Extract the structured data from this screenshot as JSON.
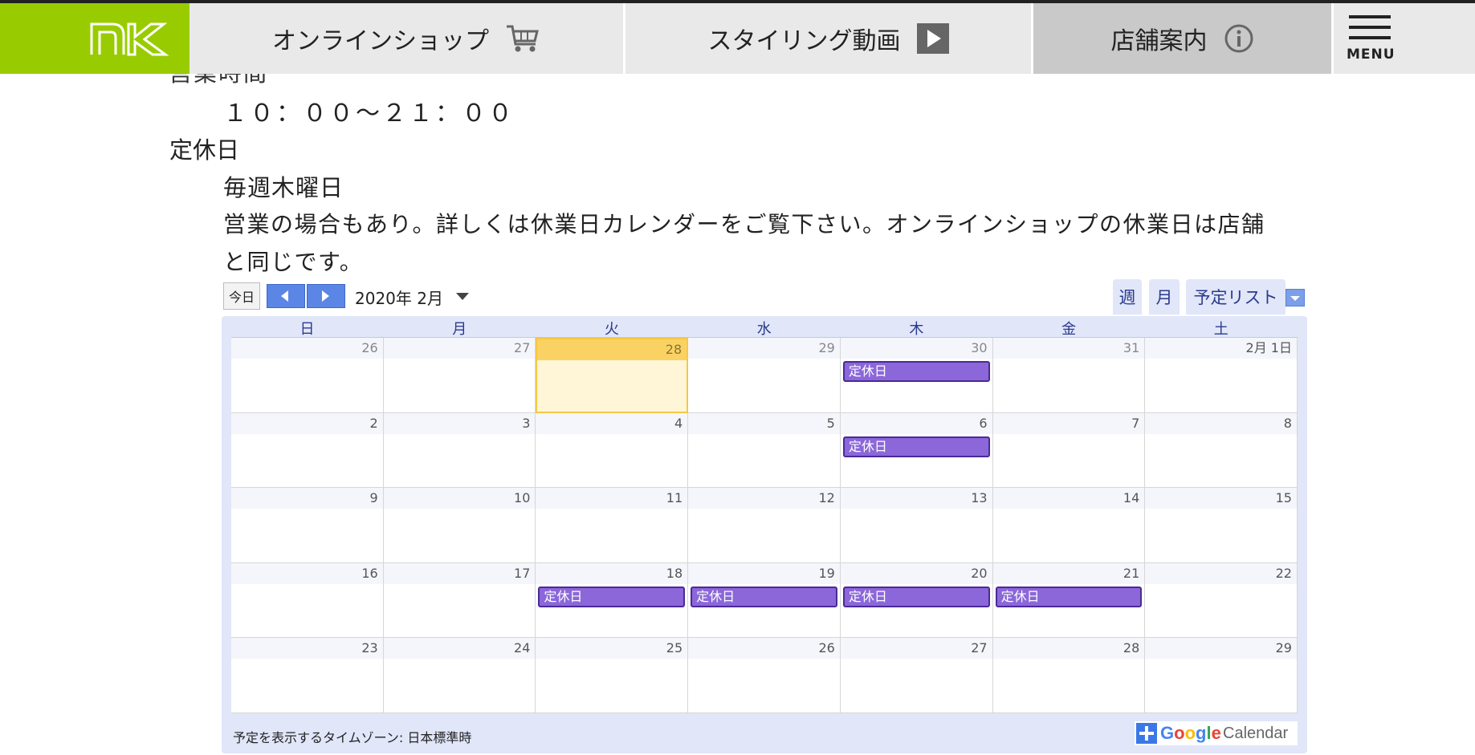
{
  "nav": {
    "logo_text": "nk",
    "items": [
      {
        "label": "オンラインショップ",
        "icon": "cart-icon"
      },
      {
        "label": "スタイリング動画",
        "icon": "play-icon"
      },
      {
        "label": "店舗案内",
        "icon": "info-icon"
      }
    ],
    "menu_label": "MENU",
    "colors": {
      "logo_bg": "#99cc00",
      "nav_bg": "#e9e9e9",
      "active_bg": "#c9c9c9"
    }
  },
  "info": {
    "hours_heading": "営業時間",
    "hours_value": "１０：００～２１：００",
    "closed_heading": "定休日",
    "closed_value": "毎週木曜日",
    "note_line1": "営業の場合もあり。詳しくは休業日カレンダーをご覧下さい。オンラインショップの休業日は店舗",
    "note_line2": "と同じです。"
  },
  "calendar": {
    "today_button": "今日",
    "month_title": "2020年 2月",
    "view_tabs": [
      "週",
      "月",
      "予定リスト"
    ],
    "weekdays": [
      "日",
      "月",
      "火",
      "水",
      "木",
      "金",
      "土"
    ],
    "weeks": [
      [
        {
          "d": "26",
          "other": true
        },
        {
          "d": "27",
          "other": true
        },
        {
          "d": "28",
          "other": true,
          "today": true
        },
        {
          "d": "29",
          "other": true
        },
        {
          "d": "30",
          "other": true
        },
        {
          "d": "31",
          "other": true
        },
        {
          "d": "2月 1日"
        }
      ],
      [
        {
          "d": "2"
        },
        {
          "d": "3"
        },
        {
          "d": "4"
        },
        {
          "d": "5"
        },
        {
          "d": "6"
        },
        {
          "d": "7"
        },
        {
          "d": "8"
        }
      ],
      [
        {
          "d": "9"
        },
        {
          "d": "10"
        },
        {
          "d": "11"
        },
        {
          "d": "12"
        },
        {
          "d": "13"
        },
        {
          "d": "14"
        },
        {
          "d": "15"
        }
      ],
      [
        {
          "d": "16"
        },
        {
          "d": "17"
        },
        {
          "d": "18"
        },
        {
          "d": "19"
        },
        {
          "d": "20"
        },
        {
          "d": "21"
        },
        {
          "d": "22"
        }
      ],
      [
        {
          "d": "23"
        },
        {
          "d": "24"
        },
        {
          "d": "25"
        },
        {
          "d": "26"
        },
        {
          "d": "27"
        },
        {
          "d": "28"
        },
        {
          "d": "29"
        }
      ]
    ],
    "events": [
      {
        "week": 0,
        "day": 4,
        "title": "定休日"
      },
      {
        "week": 1,
        "day": 4,
        "title": "定休日"
      },
      {
        "week": 3,
        "day": 2,
        "title": "定休日"
      },
      {
        "week": 3,
        "day": 3,
        "title": "定休日"
      },
      {
        "week": 3,
        "day": 4,
        "title": "定休日"
      },
      {
        "week": 3,
        "day": 5,
        "title": "定休日"
      }
    ],
    "event_color": "#8b67d9",
    "timezone_label": "予定を表示するタイムゾーン: 日本標準時",
    "gcal": {
      "google": "Google",
      "calendar": "Calendar"
    }
  }
}
